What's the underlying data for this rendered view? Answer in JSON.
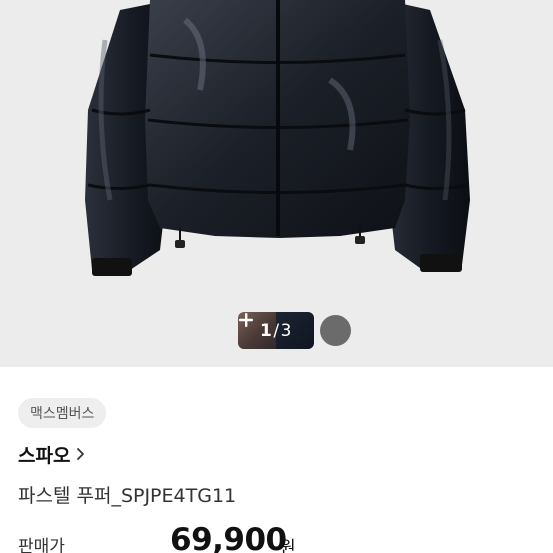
{
  "gallery": {
    "current": "1",
    "separator": "/",
    "total": "3",
    "more_icon": "plus-icon"
  },
  "seller": {
    "badge": "맥스멤버스"
  },
  "product": {
    "brand": "스파오",
    "brand_icon": "chevron-right-icon",
    "title": "파스텔 푸퍼_SPJPE4TG11",
    "price_label": "판매가",
    "price": "69,900",
    "price_unit": "원"
  }
}
